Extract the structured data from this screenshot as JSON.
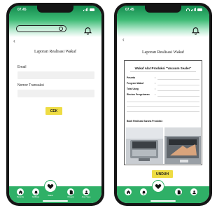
{
  "status_bar": {
    "time": "07.45"
  },
  "left_screen": {
    "title": "Laporan Realisasi Wakaf",
    "email_label": "Email",
    "transaksi_label": "Nomor Transaksi",
    "cek_label": "CEK"
  },
  "right_screen": {
    "title": "Laporan Realisasi Wakaf",
    "card": {
      "heading": "Wakaf Alat Produksi \"Vacuum Sealer\"",
      "fields": [
        {
          "label": "Peserta"
        },
        {
          "label": "Program Wakaf"
        },
        {
          "label": "Total Uang"
        },
        {
          "label": "Rincian Pengeluaran"
        }
      ],
      "bukti_label": "Bukti Realisasi Sarana Produksi :"
    },
    "unduh_label": "UNDUH"
  },
  "nav": {
    "items": [
      {
        "label": "Beranda",
        "icon": "home-icon"
      },
      {
        "label": "Notifikasi",
        "icon": "bell-icon"
      },
      {
        "label": "Wakaf",
        "icon": "hands-heart-icon"
      },
      {
        "label": "Riwayat",
        "icon": "document-icon"
      },
      {
        "label": "Akun Saya",
        "icon": "user-icon"
      }
    ]
  },
  "colors": {
    "green": "#2fb067",
    "accent_yellow": "#eedc44"
  }
}
